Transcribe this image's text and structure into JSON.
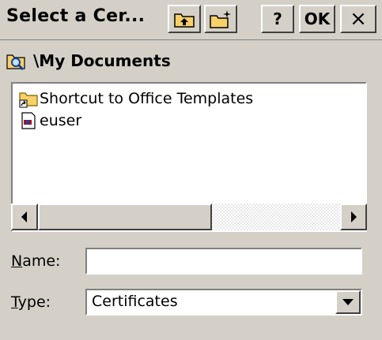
{
  "window": {
    "title": "Select a Cer...",
    "help_label": "?",
    "ok_label": "OK",
    "close_label": "×"
  },
  "path": {
    "text": "\\My Documents",
    "icon": "folder-search-icon"
  },
  "files": [
    {
      "name": "Shortcut to Office Templates",
      "icon": "folder-shortcut-icon"
    },
    {
      "name": "euser",
      "icon": "certificate-file-icon"
    }
  ],
  "scroll": {
    "position": 0
  },
  "name_field": {
    "label_underlined": "N",
    "label_rest": "ame:",
    "value": ""
  },
  "type_field": {
    "label_underlined": "T",
    "label_rest": "ype:",
    "value": "Certificates"
  },
  "colors": {
    "chrome": "#d4d0c8",
    "folder_yellow": "#f8d068"
  }
}
